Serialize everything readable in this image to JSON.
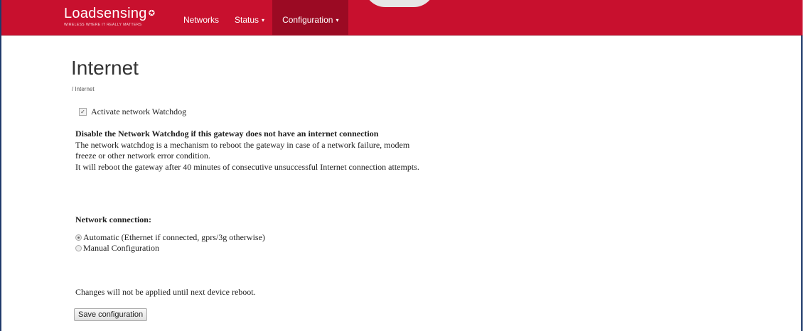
{
  "brand": {
    "name": "Loadsensing",
    "tagline": "WIRELESS WHERE IT REALLY MATTERS"
  },
  "nav": {
    "items": [
      {
        "label": "Networks"
      },
      {
        "label": "Status",
        "dropdown": true
      },
      {
        "label": "Configuration",
        "dropdown": true,
        "active": true
      }
    ],
    "caret": "▾"
  },
  "page": {
    "title": "Internet",
    "breadcrumb": "/ Internet"
  },
  "watchdog": {
    "label": "Activate network Watchdog",
    "checked": true,
    "warning_heading": "Disable the Network Watchdog if this gateway does not have an internet connection",
    "description_lines": [
      "The network watchdog is a mechanism to reboot the gateway in case of a network failure, modem",
      "freeze or other network error condition.",
      "It will reboot the gateway after 40 minutes of consecutive unsuccessful Internet connection attempts."
    ]
  },
  "network_connection": {
    "label": "Network connection:",
    "options": [
      {
        "label": "Automatic (Ethernet if connected, gprs/3g otherwise)",
        "selected": true
      },
      {
        "label": "Manual Configuration",
        "selected": false
      }
    ]
  },
  "footer": {
    "note": "Changes will not be applied until next device reboot.",
    "save_label": "Save configuration"
  },
  "colors": {
    "navbar": "#c8102e",
    "nav_active": "#9b0a23"
  }
}
